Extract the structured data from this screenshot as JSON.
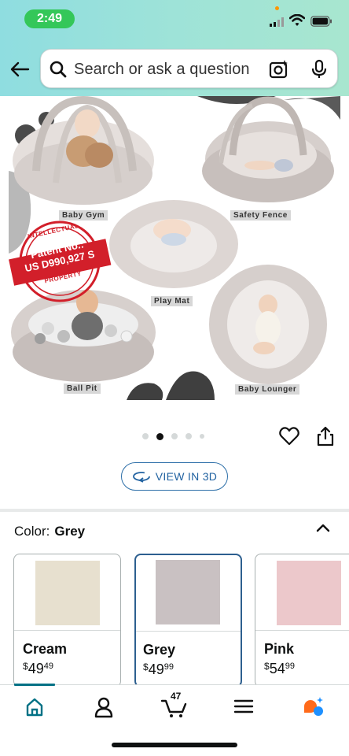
{
  "status_bar": {
    "time": "2:49"
  },
  "search": {
    "placeholder": "Search or ask a question"
  },
  "hero": {
    "labels": {
      "baby_gym": "Baby Gym",
      "safety_fence": "Safety Fence",
      "play_mat": "Play Mat",
      "ball_pit": "Ball Pit",
      "baby_lounger": "Baby Lounger"
    },
    "stamp": {
      "top_text": "INTELLECTUAL",
      "line1": "Patent No.:",
      "line2": "US D990,927 S",
      "bottom_text": "PROPERTY"
    }
  },
  "carousel": {
    "total_dots": 5,
    "active_index": 1
  },
  "view3d": {
    "label": "VIEW IN 3D"
  },
  "color_selector": {
    "key": "Color:",
    "selected": "Grey",
    "options": [
      {
        "name": "Cream",
        "currency": "$",
        "price_whole": "49",
        "price_fraction": "49",
        "swatch_color": "#e7e0cf"
      },
      {
        "name": "Grey",
        "currency": "$",
        "price_whole": "49",
        "price_fraction": "99",
        "swatch_color": "#c9c1c2",
        "selected": true
      },
      {
        "name": "Pink",
        "currency": "$",
        "price_whole": "54",
        "price_fraction": "99",
        "swatch_color": "#ecc8cb"
      }
    ]
  },
  "bottom_nav": {
    "items": [
      "home-icon",
      "account-icon",
      "cart-icon",
      "menu-icon",
      "ai-assistant-icon"
    ],
    "cart_count": "47"
  },
  "colors": {
    "header_gradient_start": "#8fdde0",
    "header_gradient_end": "#a8e6cf",
    "link_blue": "#2162a1",
    "selected_border": "#2d5f8f",
    "teal_accent": "#007185",
    "time_pill": "#34c759",
    "stamp_red": "#d21f2a"
  }
}
